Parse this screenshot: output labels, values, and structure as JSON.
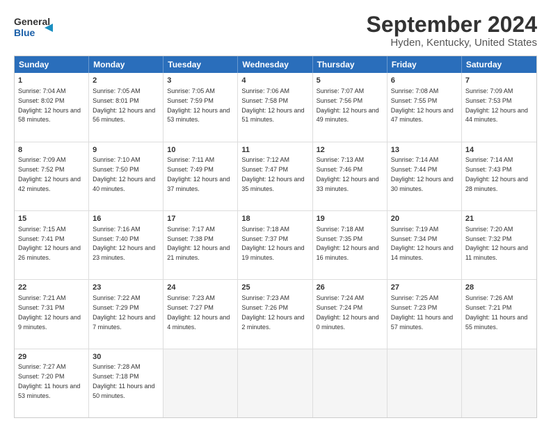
{
  "header": {
    "logo_line1": "General",
    "logo_line2": "Blue",
    "title": "September 2024",
    "subtitle": "Hyden, Kentucky, United States"
  },
  "calendar": {
    "days_of_week": [
      "Sunday",
      "Monday",
      "Tuesday",
      "Wednesday",
      "Thursday",
      "Friday",
      "Saturday"
    ],
    "weeks": [
      [
        {
          "day": "",
          "sunrise": "",
          "sunset": "",
          "daylight": "",
          "empty": true
        },
        {
          "day": "2",
          "sunrise": "Sunrise: 7:05 AM",
          "sunset": "Sunset: 8:01 PM",
          "daylight": "Daylight: 12 hours and 56 minutes."
        },
        {
          "day": "3",
          "sunrise": "Sunrise: 7:05 AM",
          "sunset": "Sunset: 7:59 PM",
          "daylight": "Daylight: 12 hours and 53 minutes."
        },
        {
          "day": "4",
          "sunrise": "Sunrise: 7:06 AM",
          "sunset": "Sunset: 7:58 PM",
          "daylight": "Daylight: 12 hours and 51 minutes."
        },
        {
          "day": "5",
          "sunrise": "Sunrise: 7:07 AM",
          "sunset": "Sunset: 7:56 PM",
          "daylight": "Daylight: 12 hours and 49 minutes."
        },
        {
          "day": "6",
          "sunrise": "Sunrise: 7:08 AM",
          "sunset": "Sunset: 7:55 PM",
          "daylight": "Daylight: 12 hours and 47 minutes."
        },
        {
          "day": "7",
          "sunrise": "Sunrise: 7:09 AM",
          "sunset": "Sunset: 7:53 PM",
          "daylight": "Daylight: 12 hours and 44 minutes."
        }
      ],
      [
        {
          "day": "8",
          "sunrise": "Sunrise: 7:09 AM",
          "sunset": "Sunset: 7:52 PM",
          "daylight": "Daylight: 12 hours and 42 minutes."
        },
        {
          "day": "9",
          "sunrise": "Sunrise: 7:10 AM",
          "sunset": "Sunset: 7:50 PM",
          "daylight": "Daylight: 12 hours and 40 minutes."
        },
        {
          "day": "10",
          "sunrise": "Sunrise: 7:11 AM",
          "sunset": "Sunset: 7:49 PM",
          "daylight": "Daylight: 12 hours and 37 minutes."
        },
        {
          "day": "11",
          "sunrise": "Sunrise: 7:12 AM",
          "sunset": "Sunset: 7:47 PM",
          "daylight": "Daylight: 12 hours and 35 minutes."
        },
        {
          "day": "12",
          "sunrise": "Sunrise: 7:13 AM",
          "sunset": "Sunset: 7:46 PM",
          "daylight": "Daylight: 12 hours and 33 minutes."
        },
        {
          "day": "13",
          "sunrise": "Sunrise: 7:14 AM",
          "sunset": "Sunset: 7:44 PM",
          "daylight": "Daylight: 12 hours and 30 minutes."
        },
        {
          "day": "14",
          "sunrise": "Sunrise: 7:14 AM",
          "sunset": "Sunset: 7:43 PM",
          "daylight": "Daylight: 12 hours and 28 minutes."
        }
      ],
      [
        {
          "day": "15",
          "sunrise": "Sunrise: 7:15 AM",
          "sunset": "Sunset: 7:41 PM",
          "daylight": "Daylight: 12 hours and 26 minutes."
        },
        {
          "day": "16",
          "sunrise": "Sunrise: 7:16 AM",
          "sunset": "Sunset: 7:40 PM",
          "daylight": "Daylight: 12 hours and 23 minutes."
        },
        {
          "day": "17",
          "sunrise": "Sunrise: 7:17 AM",
          "sunset": "Sunset: 7:38 PM",
          "daylight": "Daylight: 12 hours and 21 minutes."
        },
        {
          "day": "18",
          "sunrise": "Sunrise: 7:18 AM",
          "sunset": "Sunset: 7:37 PM",
          "daylight": "Daylight: 12 hours and 19 minutes."
        },
        {
          "day": "19",
          "sunrise": "Sunrise: 7:18 AM",
          "sunset": "Sunset: 7:35 PM",
          "daylight": "Daylight: 12 hours and 16 minutes."
        },
        {
          "day": "20",
          "sunrise": "Sunrise: 7:19 AM",
          "sunset": "Sunset: 7:34 PM",
          "daylight": "Daylight: 12 hours and 14 minutes."
        },
        {
          "day": "21",
          "sunrise": "Sunrise: 7:20 AM",
          "sunset": "Sunset: 7:32 PM",
          "daylight": "Daylight: 12 hours and 11 minutes."
        }
      ],
      [
        {
          "day": "22",
          "sunrise": "Sunrise: 7:21 AM",
          "sunset": "Sunset: 7:31 PM",
          "daylight": "Daylight: 12 hours and 9 minutes."
        },
        {
          "day": "23",
          "sunrise": "Sunrise: 7:22 AM",
          "sunset": "Sunset: 7:29 PM",
          "daylight": "Daylight: 12 hours and 7 minutes."
        },
        {
          "day": "24",
          "sunrise": "Sunrise: 7:23 AM",
          "sunset": "Sunset: 7:27 PM",
          "daylight": "Daylight: 12 hours and 4 minutes."
        },
        {
          "day": "25",
          "sunrise": "Sunrise: 7:23 AM",
          "sunset": "Sunset: 7:26 PM",
          "daylight": "Daylight: 12 hours and 2 minutes."
        },
        {
          "day": "26",
          "sunrise": "Sunrise: 7:24 AM",
          "sunset": "Sunset: 7:24 PM",
          "daylight": "Daylight: 12 hours and 0 minutes."
        },
        {
          "day": "27",
          "sunrise": "Sunrise: 7:25 AM",
          "sunset": "Sunset: 7:23 PM",
          "daylight": "Daylight: 11 hours and 57 minutes."
        },
        {
          "day": "28",
          "sunrise": "Sunrise: 7:26 AM",
          "sunset": "Sunset: 7:21 PM",
          "daylight": "Daylight: 11 hours and 55 minutes."
        }
      ],
      [
        {
          "day": "29",
          "sunrise": "Sunrise: 7:27 AM",
          "sunset": "Sunset: 7:20 PM",
          "daylight": "Daylight: 11 hours and 53 minutes."
        },
        {
          "day": "30",
          "sunrise": "Sunrise: 7:28 AM",
          "sunset": "Sunset: 7:18 PM",
          "daylight": "Daylight: 11 hours and 50 minutes."
        },
        {
          "day": "",
          "sunrise": "",
          "sunset": "",
          "daylight": "",
          "empty": true
        },
        {
          "day": "",
          "sunrise": "",
          "sunset": "",
          "daylight": "",
          "empty": true
        },
        {
          "day": "",
          "sunrise": "",
          "sunset": "",
          "daylight": "",
          "empty": true
        },
        {
          "day": "",
          "sunrise": "",
          "sunset": "",
          "daylight": "",
          "empty": true
        },
        {
          "day": "",
          "sunrise": "",
          "sunset": "",
          "daylight": "",
          "empty": true
        }
      ]
    ],
    "week0_day1": {
      "day": "1",
      "sunrise": "Sunrise: 7:04 AM",
      "sunset": "Sunset: 8:02 PM",
      "daylight": "Daylight: 12 hours and 58 minutes."
    }
  }
}
